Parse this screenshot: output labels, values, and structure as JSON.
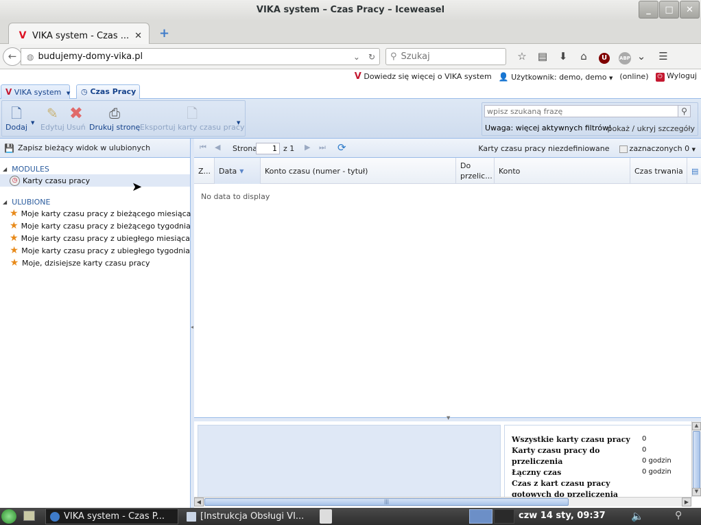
{
  "window": {
    "title": "VIKA system – Czas Pracy – Iceweasel",
    "buttons": [
      "_",
      "□",
      "✕"
    ]
  },
  "browser": {
    "tab_title": "VIKA system - Czas ...",
    "tab_close": "✕",
    "new_tab": "+",
    "url": "budujemy-domy-vika.pl",
    "search_placeholder": "Szukaj"
  },
  "app_header": {
    "learn_more": "Dowiedz się więcej o VIKA system",
    "user_label": "Użytkownik: demo, demo",
    "online": "(online)",
    "logout": "Wyloguj"
  },
  "module_tabs": {
    "vika": "VIKA system",
    "czas_pracy": "Czas Pracy"
  },
  "toolbar": {
    "add": "Dodaj",
    "edit": "Edytuj",
    "delete": "Usuń",
    "print": "Drukuj stronę",
    "export": "Eksportuj karty czasu pracy",
    "search_placeholder": "wpisz szukaną frazę",
    "filters_note": "Uwaga: więcej aktywnych filtrów!",
    "toggle_details": "pokaż / ukryj szczegóły"
  },
  "left_panel": {
    "save_view": "Zapisz bieżący widok w ulubionych",
    "modules_label": "MODULES",
    "modules_items": [
      "Karty czasu pracy"
    ],
    "favorites_label": "ULUBIONE",
    "favorites_items": [
      "Moje karty czasu pracy z bieżącego miesiąca",
      "Moje karty czasu pracy z bieżącego tygodnia",
      "Moje karty czasu pracy z ubiegłego miesiąca",
      "Moje karty czasu pracy z ubiegłego tygodnia",
      "Moje, dzisiejsze karty czasu pracy"
    ]
  },
  "paging": {
    "page_label": "Strona",
    "page_value": "1",
    "of_label": "z 1",
    "undefined_label": "Karty czasu pracy niezdefiniowane",
    "selected_label": "zaznaczonych 0"
  },
  "grid": {
    "columns": [
      "Z...",
      "Data",
      "Konto czasu (numer - tytuł)",
      "Do przelic...",
      "Konto",
      "Czas trwania"
    ],
    "empty_text": "No data to display"
  },
  "summary": {
    "rows": [
      {
        "label": "Wszystkie karty czasu pracy",
        "value": "0"
      },
      {
        "label": "Karty czasu pracy do przeliczenia",
        "value": "0"
      },
      {
        "label": "",
        "value": "0 godzin"
      },
      {
        "label": "Łączny czas",
        "value": "0 godzin"
      },
      {
        "label": "Czas z kart czasu pracy gotowych do przeliczenia",
        "value": ""
      }
    ]
  },
  "taskbar": {
    "task1": "VIKA system - Czas P...",
    "task2": "[Instrukcja Obsługi VI...",
    "clock": "czw 14 sty, 09:37"
  }
}
